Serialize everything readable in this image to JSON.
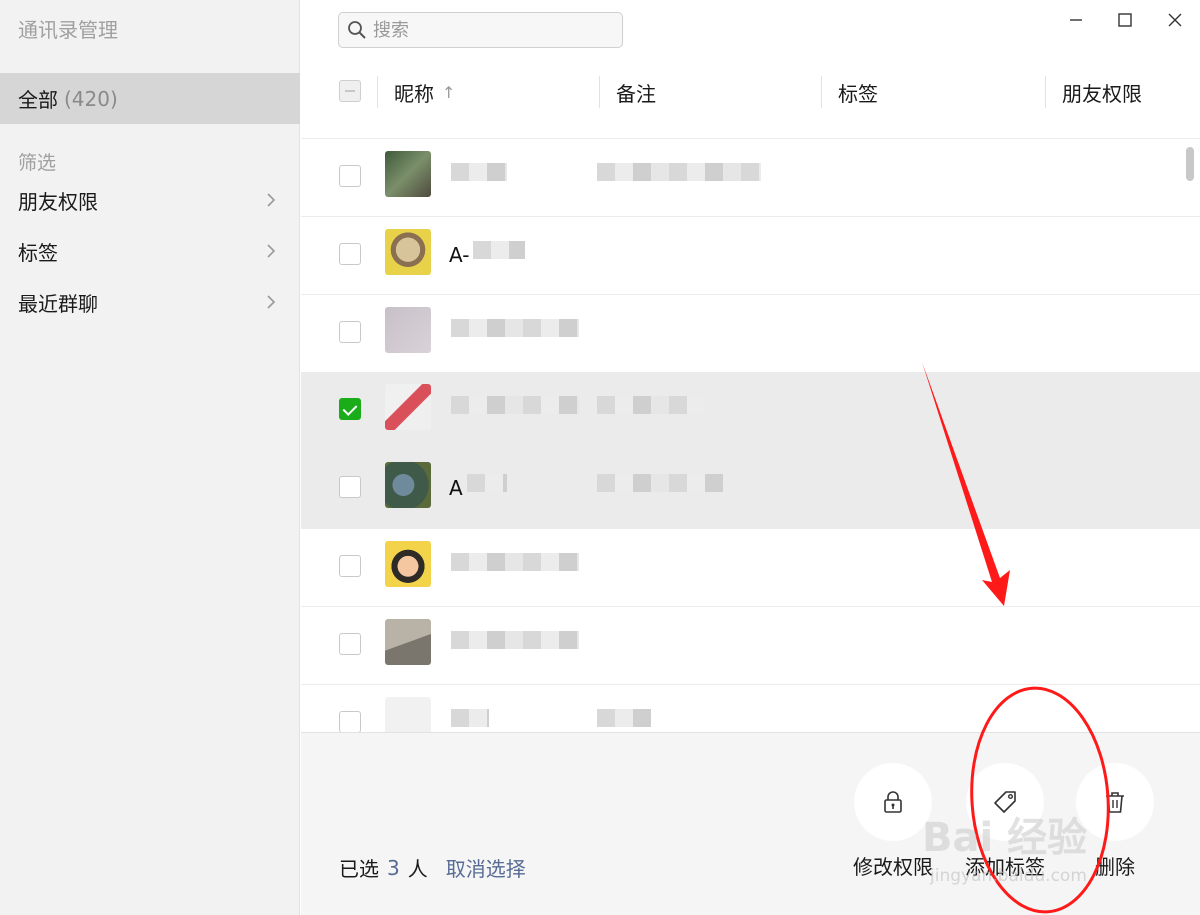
{
  "app": {
    "title": "通讯录管理"
  },
  "sidebar": {
    "all_label": "全部",
    "all_count": "(420)",
    "filter_label": "筛选",
    "items": [
      {
        "label": "朋友权限"
      },
      {
        "label": "标签"
      },
      {
        "label": "最近群聊"
      }
    ]
  },
  "search": {
    "placeholder": "搜索"
  },
  "table": {
    "columns": [
      "昵称",
      "备注",
      "标签",
      "朋友权限"
    ],
    "sort_indicator": "↑",
    "rows": [
      {
        "nickname": "",
        "checked": false
      },
      {
        "nickname": "A-",
        "checked": false
      },
      {
        "nickname": "",
        "checked": false
      },
      {
        "nickname": "",
        "checked": true
      },
      {
        "nickname": "A",
        "checked": false
      },
      {
        "nickname": "",
        "checked": false
      },
      {
        "nickname": "",
        "checked": false
      },
      {
        "nickname": "",
        "checked": false
      }
    ]
  },
  "footer": {
    "selected_prefix": "已选",
    "selected_count": "3",
    "selected_suffix": "人",
    "cancel_label": "取消选择",
    "actions": [
      {
        "label": "修改权限",
        "icon": "lock-icon"
      },
      {
        "label": "添加标签",
        "icon": "tag-icon"
      },
      {
        "label": "删除",
        "icon": "trash-icon"
      }
    ]
  },
  "watermark": {
    "brand": "Bai 经验",
    "url": "jingyan.baidu.com"
  },
  "colors": {
    "accent_green": "#1aad19",
    "link_blue": "#576b95",
    "annotation_red": "#ff1a1a"
  }
}
